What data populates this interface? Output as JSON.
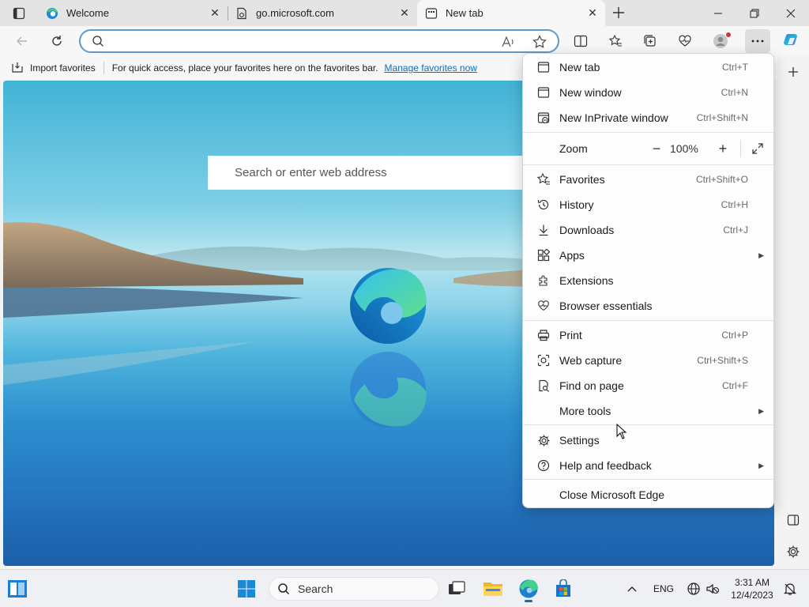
{
  "tabs": [
    {
      "title": "Welcome",
      "icon": "edge-icon",
      "active": false
    },
    {
      "title": "go.microsoft.com",
      "icon": "page-icon",
      "active": false
    },
    {
      "title": "New tab",
      "icon": "newtab-page-icon",
      "active": true
    }
  ],
  "address_bar": {
    "value": "",
    "placeholder": ""
  },
  "favorites_bar": {
    "import_label": "Import favorites",
    "hint": "For quick access, place your favorites here on the favorites bar.",
    "manage_link": "Manage favorites now"
  },
  "new_tab_page": {
    "search_placeholder": "Search or enter web address"
  },
  "menu": {
    "items_top": [
      {
        "label": "New tab",
        "shortcut": "Ctrl+T",
        "icon": "new-tab-icon"
      },
      {
        "label": "New window",
        "shortcut": "Ctrl+N",
        "icon": "new-window-icon"
      },
      {
        "label": "New InPrivate window",
        "shortcut": "Ctrl+Shift+N",
        "icon": "inprivate-icon"
      }
    ],
    "zoom": {
      "label": "Zoom",
      "value": "100%"
    },
    "items_mid": [
      {
        "label": "Favorites",
        "shortcut": "Ctrl+Shift+O",
        "icon": "favorites-icon"
      },
      {
        "label": "History",
        "shortcut": "Ctrl+H",
        "icon": "history-icon"
      },
      {
        "label": "Downloads",
        "shortcut": "Ctrl+J",
        "icon": "download-icon"
      },
      {
        "label": "Apps",
        "shortcut": "",
        "icon": "apps-icon",
        "submenu": true
      },
      {
        "label": "Extensions",
        "shortcut": "",
        "icon": "extensions-icon"
      },
      {
        "label": "Browser essentials",
        "shortcut": "",
        "icon": "heart-pulse-icon"
      }
    ],
    "items_tools": [
      {
        "label": "Print",
        "shortcut": "Ctrl+P",
        "icon": "printer-icon"
      },
      {
        "label": "Web capture",
        "shortcut": "Ctrl+Shift+S",
        "icon": "web-capture-icon"
      },
      {
        "label": "Find on page",
        "shortcut": "Ctrl+F",
        "icon": "find-icon"
      },
      {
        "label": "More tools",
        "shortcut": "",
        "icon": "",
        "submenu": true
      }
    ],
    "items_settings": [
      {
        "label": "Settings",
        "shortcut": "",
        "icon": "gear-icon"
      },
      {
        "label": "Help and feedback",
        "shortcut": "",
        "icon": "help-icon",
        "submenu": true
      }
    ],
    "close_label": "Close Microsoft Edge"
  },
  "taskbar": {
    "search_label": "Search",
    "language": "ENG",
    "time": "3:31 AM",
    "date": "12/4/2023"
  },
  "colors": {
    "accent": "#0f6cbd",
    "menu_bg": "#fdfdfd",
    "taskbar_bg": "#eef0f3"
  }
}
